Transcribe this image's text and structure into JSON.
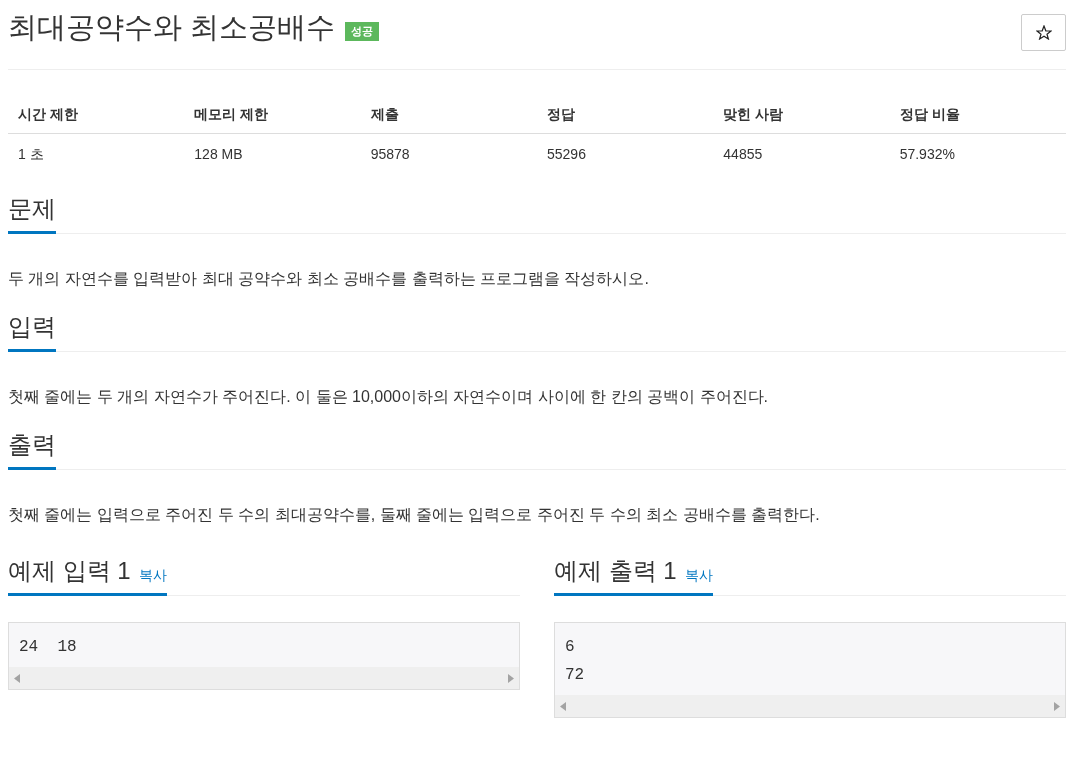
{
  "title": "최대공약수와 최소공배수",
  "result_badge": "성공",
  "info_table": {
    "columns": [
      "시간 제한",
      "메모리 제한",
      "제출",
      "정답",
      "맞힌 사람",
      "정답 비율"
    ],
    "rows": [
      [
        "1 초",
        "128 MB",
        "95878",
        "55296",
        "44855",
        "57.932%"
      ]
    ]
  },
  "sections": [
    {
      "heading": "문제",
      "text": "두 개의 자연수를 입력받아 최대 공약수와 최소 공배수를 출력하는 프로그램을 작성하시오."
    },
    {
      "heading": "입력",
      "text": "첫째 줄에는 두 개의 자연수가 주어진다. 이 둘은 10,000이하의 자연수이며 사이에 한 칸의 공백이 주어진다."
    },
    {
      "heading": "출력",
      "text": "첫째 줄에는 입력으로 주어진 두 수의 최대공약수를, 둘째 줄에는 입력으로 주어진 두 수의 최소 공배수를 출력한다."
    }
  ],
  "samples": [
    {
      "heading": "예제 입력 1",
      "copy_link": "복사",
      "lines": [
        "24  18"
      ]
    },
    {
      "heading": "예제 출력 1",
      "copy_link": "복사",
      "lines": [
        "6",
        "72"
      ]
    }
  ]
}
